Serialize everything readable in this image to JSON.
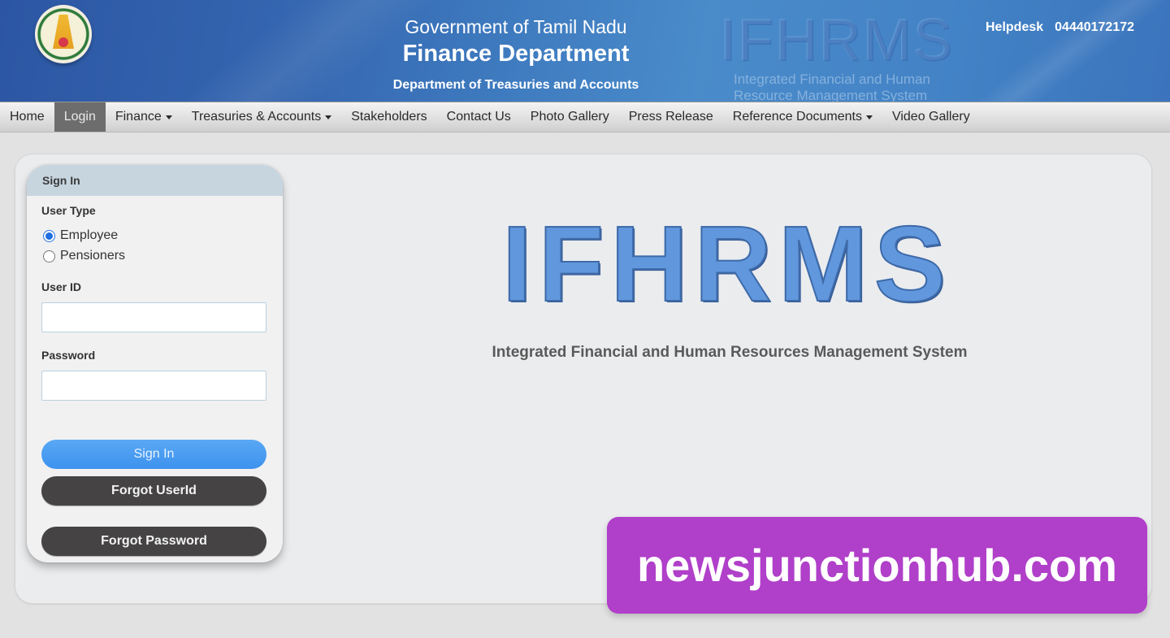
{
  "header": {
    "gov_title": "Government of Tamil Nadu",
    "dept_title": "Finance Department",
    "sub_dept": "Department of Treasuries and Accounts",
    "watermark_logo": "IFHRMS",
    "watermark_sub": "Integrated Financial and Human Resource Management System",
    "helpdesk_label": "Helpdesk",
    "helpdesk_number": "04440172172",
    "emblem_icon": "tamil-nadu-emblem"
  },
  "nav": {
    "items": [
      {
        "label": "Home",
        "active": false,
        "dropdown": false
      },
      {
        "label": "Login",
        "active": true,
        "dropdown": false
      },
      {
        "label": "Finance",
        "active": false,
        "dropdown": true
      },
      {
        "label": "Treasuries & Accounts",
        "active": false,
        "dropdown": true
      },
      {
        "label": "Stakeholders",
        "active": false,
        "dropdown": false
      },
      {
        "label": "Contact Us",
        "active": false,
        "dropdown": false
      },
      {
        "label": "Photo Gallery",
        "active": false,
        "dropdown": false
      },
      {
        "label": "Press Release",
        "active": false,
        "dropdown": false
      },
      {
        "label": "Reference Documents",
        "active": false,
        "dropdown": true
      },
      {
        "label": "Video Gallery",
        "active": false,
        "dropdown": false
      }
    ]
  },
  "signin": {
    "title": "Sign In",
    "user_type_label": "User Type",
    "user_types": [
      {
        "label": "Employee",
        "checked": true
      },
      {
        "label": "Pensioners",
        "checked": false
      }
    ],
    "user_id_label": "User ID",
    "user_id_value": "",
    "password_label": "Password",
    "password_value": "",
    "signin_button": "Sign In",
    "forgot_userid_button": "Forgot UserId",
    "forgot_password_button": "Forgot Password"
  },
  "main": {
    "logo_text": "IFHRMS",
    "subtitle": "Integrated Financial and Human Resources Management System"
  },
  "overlay": {
    "watermark_text": "newsjunctionhub.com"
  },
  "colors": {
    "header_blue": "#3f7cc0",
    "active_nav": "#6d6d6d",
    "signin_blue": "#3c92ee",
    "dark_button": "#454343",
    "watermark_purple": "#b03fc9",
    "logo_blue": "#6197dd"
  }
}
